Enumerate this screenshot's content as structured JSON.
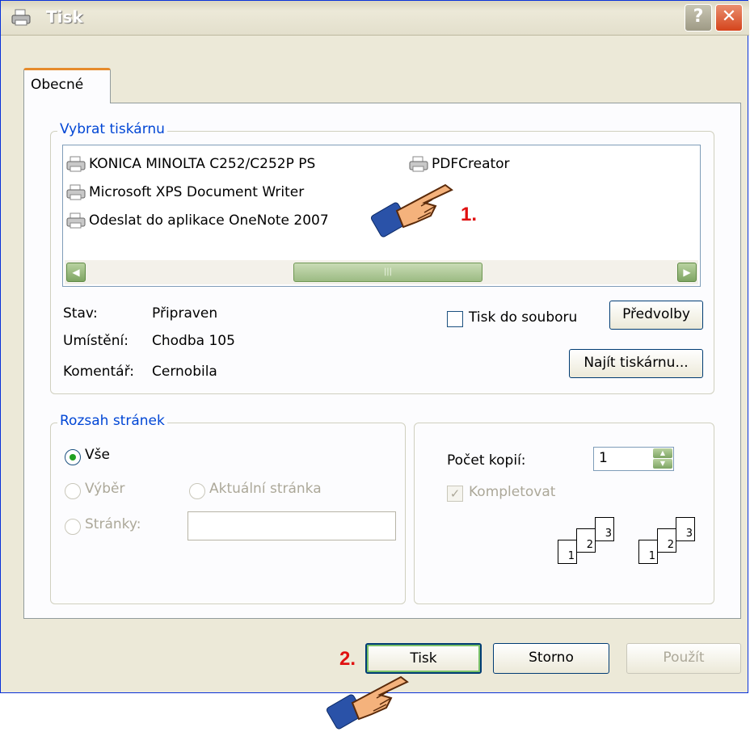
{
  "window": {
    "title": "Tisk",
    "title_icon": "printer-icon",
    "help_icon": "help-icon",
    "close_icon": "close-icon"
  },
  "tabs": [
    {
      "label": "Obecné"
    }
  ],
  "printer_group": {
    "legend": "Vybrat tiskárnu",
    "printers": [
      "KONICA MINOLTA C252/C252P PS",
      "Microsoft XPS Document Writer",
      "Odeslat do aplikace OneNote 2007",
      "PDFCreator"
    ],
    "status": {
      "label": "Stav:",
      "value": "Připraven"
    },
    "location": {
      "label": "Umístění:",
      "value": "Chodba 105"
    },
    "comment": {
      "label": "Komentář:",
      "value": "Cernobila"
    },
    "print_to_file": "Tisk do souboru",
    "preferences_button": "Předvolby",
    "find_printer_button": "Najít tiskárnu..."
  },
  "page_range": {
    "legend": "Rozsah stránek",
    "all": "Vše",
    "selection": "Výběr",
    "current_page": "Aktuální stránka",
    "pages": "Stránky:",
    "pages_value": ""
  },
  "copies": {
    "label": "Počet kopií:",
    "value": "1",
    "collate": "Kompletovat",
    "collate_checked": true,
    "stack_numbers": [
      "1",
      "2",
      "3"
    ]
  },
  "buttons": {
    "print": "Tisk",
    "cancel": "Storno",
    "apply": "Použít"
  },
  "annotations": {
    "step1": "1.",
    "step2": "2."
  },
  "colors": {
    "accent_title": "#0046d5",
    "annotation": "#e01010",
    "tab_highlight": "#e68b2c"
  }
}
